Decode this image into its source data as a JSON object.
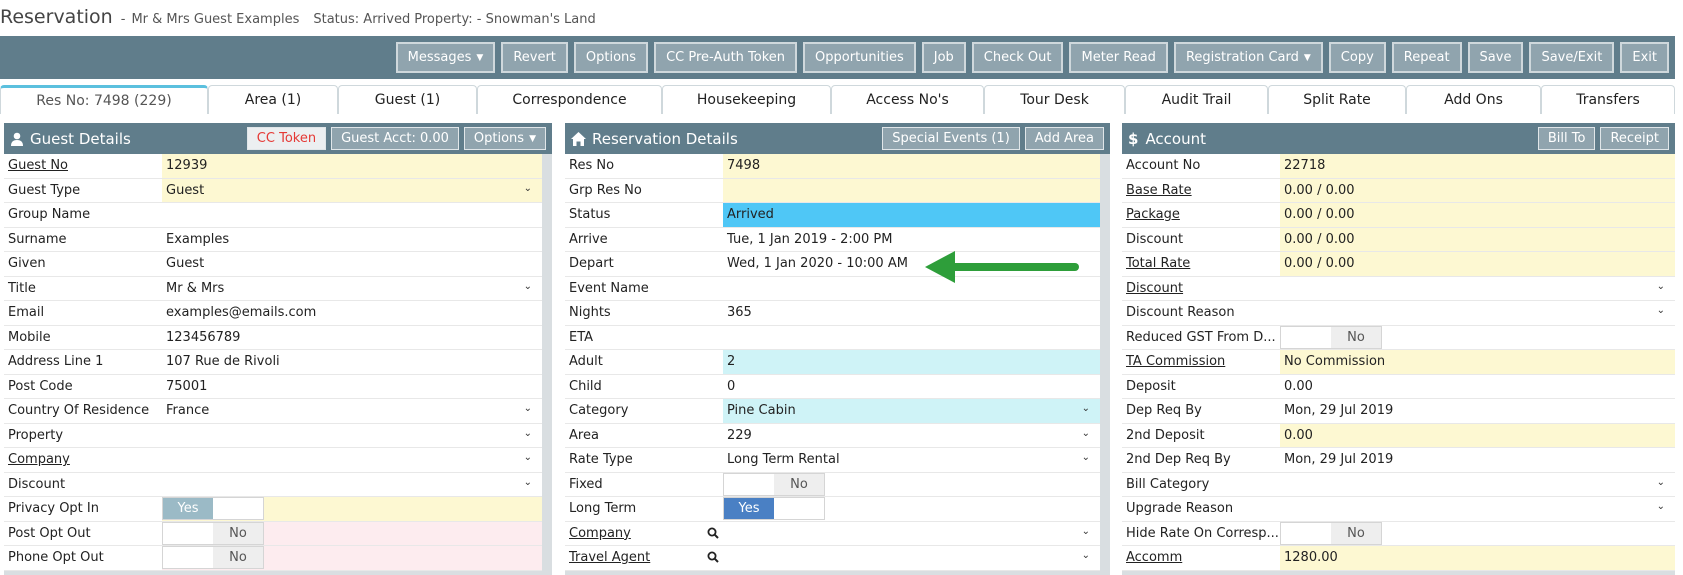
{
  "header": {
    "title": "Reservation",
    "separator": "-",
    "guest_name": "Mr & Mrs Guest Examples",
    "status_text": "Status: Arrived",
    "property_text": "Property: - Snowman's Land"
  },
  "toolbar": {
    "buttons": [
      "Messages",
      "Revert",
      "Options",
      "CC Pre-Auth Token",
      "Opportunities",
      "Job",
      "Check Out",
      "Meter Read",
      "Registration Card",
      "Copy",
      "Repeat",
      "Save",
      "Save/Exit",
      "Exit"
    ]
  },
  "tabs": [
    "Res No: 7498 (229)",
    "Area (1)",
    "Guest (1)",
    "Correspondence",
    "Housekeeping",
    "Access No's",
    "Tour Desk",
    "Audit Trail",
    "Split Rate",
    "Add Ons",
    "Transfers"
  ],
  "guest": {
    "title": "Guest Details",
    "buttons": {
      "cc_token": "CC Token",
      "guest_acct": "Guest Acct: 0.00",
      "options": "Options"
    },
    "rows": [
      {
        "label": "Guest No",
        "value": "12939"
      },
      {
        "label": "Guest Type",
        "value": "Guest"
      },
      {
        "label": "Group Name",
        "value": ""
      },
      {
        "label": "Surname",
        "value": "Examples"
      },
      {
        "label": "Given",
        "value": "Guest"
      },
      {
        "label": "Title",
        "value": "Mr & Mrs"
      },
      {
        "label": "Email",
        "value": "examples@emails.com"
      },
      {
        "label": "Mobile",
        "value": "123456789"
      },
      {
        "label": "Address Line 1",
        "value": "107 Rue de Rivoli"
      },
      {
        "label": "Post Code",
        "value": "75001"
      },
      {
        "label": "Country Of Residence",
        "value": "France"
      },
      {
        "label": "Property",
        "value": ""
      },
      {
        "label": "Company",
        "value": ""
      },
      {
        "label": "Discount",
        "value": ""
      },
      {
        "label": "Privacy Opt In",
        "value": "Yes"
      },
      {
        "label": "Post Opt Out",
        "value": "No"
      },
      {
        "label": "Phone Opt Out",
        "value": "No"
      }
    ]
  },
  "reservation": {
    "title": "Reservation Details",
    "buttons": {
      "special_events": "Special Events (1)",
      "add_area": "Add Area"
    },
    "rows": [
      {
        "label": "Res No",
        "value": "7498"
      },
      {
        "label": "Grp Res No",
        "value": ""
      },
      {
        "label": "Status",
        "value": "Arrived"
      },
      {
        "label": "Arrive",
        "value": "Tue, 1 Jan 2019 - 2:00 PM"
      },
      {
        "label": "Depart",
        "value": "Wed, 1 Jan 2020 - 10:00 AM"
      },
      {
        "label": "Event Name",
        "value": ""
      },
      {
        "label": "Nights",
        "value": "365"
      },
      {
        "label": "ETA",
        "value": ""
      },
      {
        "label": "Adult",
        "value": "2"
      },
      {
        "label": "Child",
        "value": "0"
      },
      {
        "label": "Category",
        "value": "Pine Cabin"
      },
      {
        "label": "Area",
        "value": "229"
      },
      {
        "label": "Rate Type",
        "value": "Long Term Rental"
      },
      {
        "label": "Fixed",
        "value": "No"
      },
      {
        "label": "Long Term",
        "value": "Yes"
      },
      {
        "label": "Company",
        "value": ""
      },
      {
        "label": "Travel Agent",
        "value": ""
      }
    ]
  },
  "account": {
    "title": "Account",
    "buttons": {
      "bill_to": "Bill To",
      "receipt": "Receipt"
    },
    "rows": [
      {
        "label": "Account No",
        "value": "22718"
      },
      {
        "label": "Base Rate",
        "value": "0.00 / 0.00"
      },
      {
        "label": "Package",
        "value": "0.00 / 0.00"
      },
      {
        "label": "Discount",
        "value": "0.00 / 0.00"
      },
      {
        "label": "Total Rate",
        "value": "0.00 / 0.00"
      },
      {
        "label": "Discount",
        "value": ""
      },
      {
        "label": "Discount Reason",
        "value": ""
      },
      {
        "label": "Reduced GST From D...",
        "value": "No"
      },
      {
        "label": "TA Commission",
        "value": "No Commission"
      },
      {
        "label": "Deposit",
        "value": "0.00"
      },
      {
        "label": "Dep Req By",
        "value": "Mon, 29 Jul 2019"
      },
      {
        "label": "2nd Deposit",
        "value": "0.00"
      },
      {
        "label": "2nd Dep Req By",
        "value": "Mon, 29 Jul 2019"
      },
      {
        "label": "Bill Category",
        "value": ""
      },
      {
        "label": "Upgrade Reason",
        "value": ""
      },
      {
        "label": "Hide Rate On Corresp...",
        "value": "No"
      },
      {
        "label": "Accomm",
        "value": "1280.00"
      }
    ]
  },
  "colors": {
    "toolbar": "#607d8b",
    "button": "#90a4ae",
    "highlight_yellow": "#fdf8d2",
    "status_blue": "#4fc7f6",
    "arrow_green": "#2e9e3a"
  }
}
